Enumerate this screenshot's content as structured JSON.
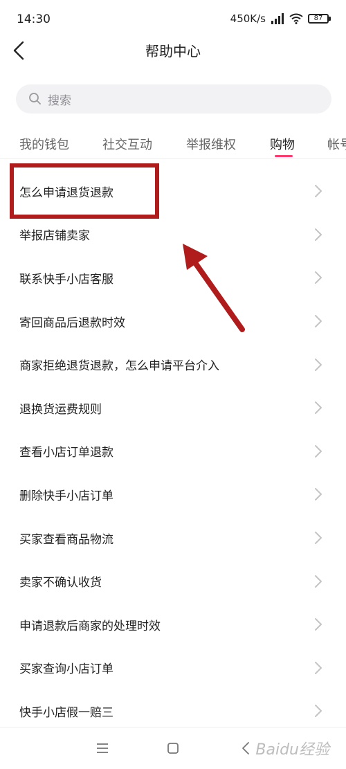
{
  "status_bar": {
    "time": "14:30",
    "network_speed": "450K/s",
    "battery": "87"
  },
  "header": {
    "title": "帮助中心"
  },
  "search": {
    "placeholder": "搜索"
  },
  "tabs": [
    {
      "label": "我的钱包"
    },
    {
      "label": "社交互动"
    },
    {
      "label": "举报维权"
    },
    {
      "label": "购物"
    },
    {
      "label": "帐号"
    }
  ],
  "list": {
    "items": [
      {
        "label": "怎么申请退货退款"
      },
      {
        "label": "举报店铺卖家"
      },
      {
        "label": "联系快手小店客服"
      },
      {
        "label": "寄回商品后退款时效"
      },
      {
        "label": "商家拒绝退货退款，怎么申请平台介入"
      },
      {
        "label": "退换货运费规则"
      },
      {
        "label": "查看小店订单退款"
      },
      {
        "label": "删除快手小店订单"
      },
      {
        "label": "买家查看商品物流"
      },
      {
        "label": "卖家不确认收货"
      },
      {
        "label": "申请退款后商家的处理时效"
      },
      {
        "label": "买家查询小店订单"
      },
      {
        "label": "快手小店假一赔三"
      }
    ]
  },
  "watermark": {
    "text": "Baidu经验"
  },
  "colors": {
    "accent": "#ff3a6e",
    "annotation": "#b01c1c"
  }
}
